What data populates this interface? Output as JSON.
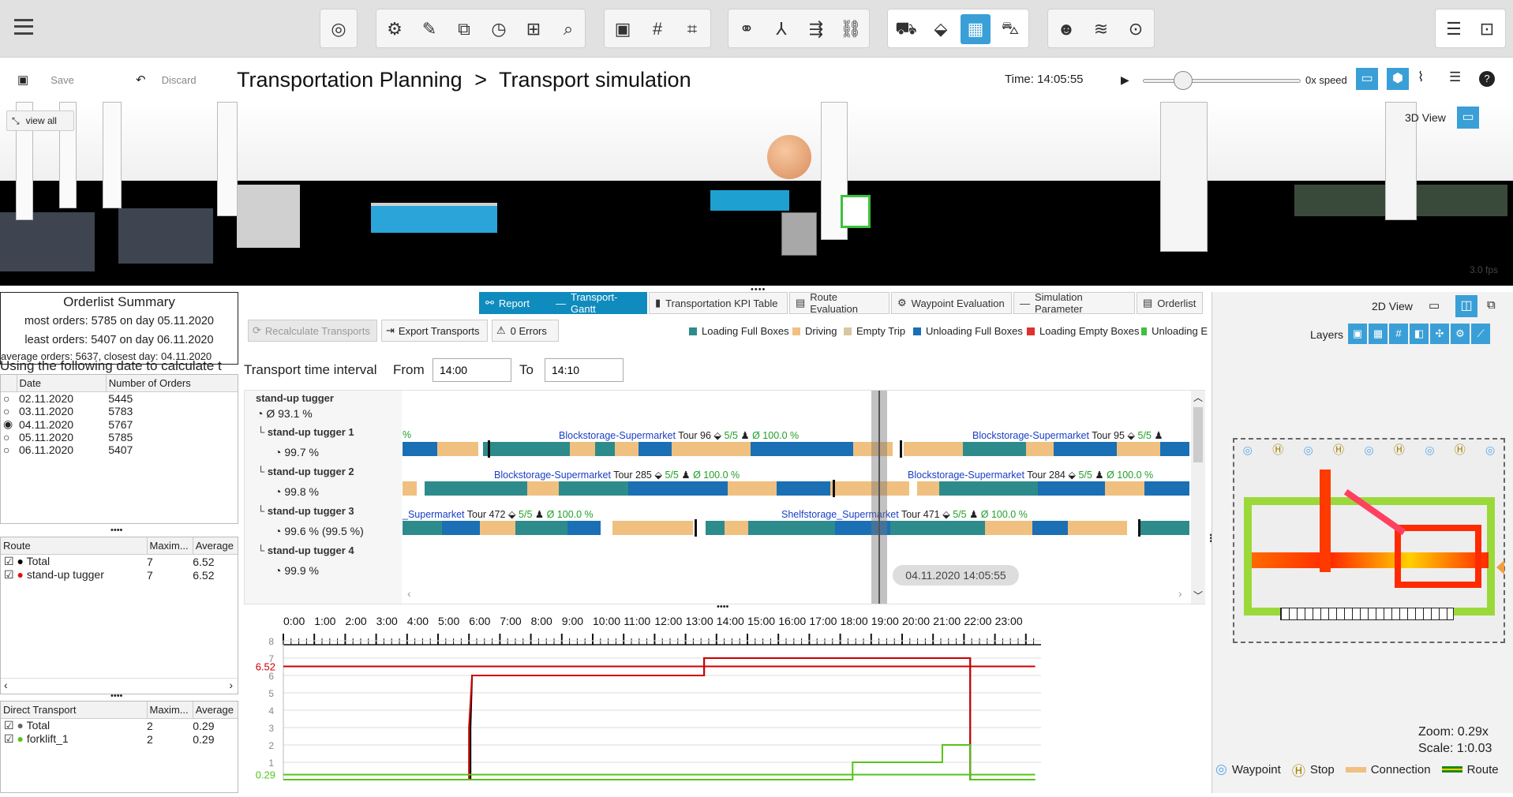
{
  "toolbar": {
    "groups": [
      [
        "target-icon"
      ],
      [
        "settings-cube-icon",
        "ruler-icon",
        "layers-icon",
        "clock-icon",
        "grid-dots-icon",
        "search-zoom-icon"
      ],
      [
        "frame-icon",
        "grid-icon",
        "corner-icon"
      ],
      [
        "link-icon",
        "branch-icon",
        "merge-icon",
        "chain-icon"
      ],
      [
        "conveyor-icon",
        "box-icon",
        "table-icon",
        "forklift-icon"
      ],
      [
        "people-icon",
        "coins-icon",
        "target-box-icon"
      ]
    ],
    "active": "table-icon"
  },
  "header": {
    "save_label": "Save",
    "discard_label": "Discard",
    "breadcrumb": "Transportation Planning",
    "separator": ">",
    "page": "Transport simulation",
    "time_label": "Time: 14:05:55",
    "speed_label": "0x speed"
  },
  "view3d": {
    "view_all": "view all",
    "mode_label": "3D View",
    "fps": "3.0 fps"
  },
  "orderlist": {
    "title": "Orderlist Summary",
    "most": "most orders: 5785 on day 05.11.2020",
    "least": "least orders: 5407 on day 06.11.2020",
    "average": "average orders: 5637, closest day: 04.11.2020",
    "using": "Using the following date to calculate t",
    "columns": [
      "Date",
      "Number of Orders"
    ],
    "rows": [
      {
        "date": "02.11.2020",
        "orders": "5445",
        "selected": false
      },
      {
        "date": "03.11.2020",
        "orders": "5783",
        "selected": false
      },
      {
        "date": "04.11.2020",
        "orders": "5767",
        "selected": true
      },
      {
        "date": "05.11.2020",
        "orders": "5785",
        "selected": false
      },
      {
        "date": "06.11.2020",
        "orders": "5407",
        "selected": false
      }
    ]
  },
  "routes": {
    "columns": [
      "Route",
      "Maxim...",
      "Average"
    ],
    "rows": [
      {
        "name": "Total",
        "max": "7",
        "avg": "6.52",
        "color": "#000000"
      },
      {
        "name": "stand-up tugger",
        "max": "7",
        "avg": "6.52",
        "color": "#e01010"
      }
    ]
  },
  "direct": {
    "columns": [
      "Direct Transport",
      "Maxim...",
      "Average"
    ],
    "rows": [
      {
        "name": "Total",
        "max": "2",
        "avg": "0.29",
        "color": "#666666"
      },
      {
        "name": "forklift_1",
        "max": "2",
        "avg": "0.29",
        "color": "#55c41a"
      }
    ]
  },
  "tabs": [
    "Report",
    "Transport-Gantt",
    "Transportation KPI Table",
    "Route Evaluation",
    "Waypoint Evaluation",
    "Simulation Parameter",
    "Orderlist"
  ],
  "actions": {
    "recalc": "Recalculate Transports",
    "export": "Export Transports",
    "errors": "0 Errors"
  },
  "legend": [
    {
      "label": "Loading Full Boxes",
      "color": "#2e8b8b"
    },
    {
      "label": "Driving",
      "color": "#f0c080"
    },
    {
      "label": "Empty Trip",
      "color": "#d8c8a0"
    },
    {
      "label": "Unloading Full Boxes",
      "color": "#1a6fb5"
    },
    {
      "label": "Loading Empty Boxes",
      "color": "#e03030"
    },
    {
      "label": "Unloading E",
      "color": "#40c040"
    }
  ],
  "interval": {
    "label": "Transport time interval",
    "from_label": "From",
    "from": "14:00",
    "to_label": "To",
    "to": "14:10"
  },
  "gantt": {
    "group": "stand-up tugger",
    "group_pct": "Ø 93.1 %",
    "rows": [
      {
        "name": "stand-up tugger 1",
        "pct": "99.7 %"
      },
      {
        "name": "stand-up tugger 2",
        "pct": "99.8 %"
      },
      {
        "name": "stand-up tugger 3",
        "pct": "99.6 % (99.5 %)"
      },
      {
        "name": "stand-up tugger 4",
        "pct": "99.9 %"
      }
    ],
    "tours": [
      {
        "row": 0,
        "pre": "%",
        "tour": "Blockstorage-Supermarket",
        "num": "Tour 96",
        "cnt": "5/5",
        "ok": "Ø 100.0 %"
      },
      {
        "row": 0,
        "tour": "Blockstorage-Supermarket",
        "num": "Tour 95",
        "cnt": "5/5"
      },
      {
        "row": 1,
        "tour": "Blockstorage-Supermarket",
        "num": "Tour 285",
        "cnt": "5/5",
        "ok": "Ø 100.0 %"
      },
      {
        "row": 1,
        "tour": "Blockstorage-Supermarket",
        "num": "Tour 284",
        "cnt": "5/5",
        "ok": "Ø 100.0 %"
      },
      {
        "row": 2,
        "tour": "_Supermarket",
        "num": "Tour 472",
        "cnt": "5/5",
        "ok": "Ø 100.0 %"
      },
      {
        "row": 2,
        "tour": "Shelfstorage_Supermarket",
        "num": "Tour 471",
        "cnt": "5/5",
        "ok": "Ø 100.0 %"
      }
    ],
    "timestamp": "04.11.2020 14:05:55"
  },
  "chart_data": {
    "type": "line",
    "x_labels": [
      "0:00",
      "1:00",
      "2:00",
      "3:00",
      "4:00",
      "5:00",
      "6:00",
      "7:00",
      "8:00",
      "9:00",
      "10:00",
      "11:00",
      "12:00",
      "13:00",
      "14:00",
      "15:00",
      "16:00",
      "17:00",
      "18:00",
      "19:00",
      "20:00",
      "21:00",
      "22:00",
      "23:00"
    ],
    "y_ticks": [
      "8",
      "7",
      "6",
      "5",
      "4",
      "3",
      "2",
      "1"
    ],
    "ylim": [
      0,
      8
    ],
    "average_labels": [
      "6.52",
      "0.29"
    ],
    "series": [
      {
        "color": "#000000",
        "points": [
          [
            0,
            0
          ],
          [
            6.05,
            0
          ],
          [
            6.05,
            3
          ],
          [
            6.1,
            6
          ],
          [
            13.6,
            6
          ],
          [
            13.6,
            7
          ],
          [
            22.2,
            7
          ],
          [
            22.2,
            0
          ],
          [
            24.3,
            0
          ]
        ]
      },
      {
        "color": "#cc0000",
        "points": [
          [
            0,
            0
          ],
          [
            6.0,
            0
          ],
          [
            6.0,
            3
          ],
          [
            6.1,
            6
          ],
          [
            13.6,
            6
          ],
          [
            13.6,
            7
          ],
          [
            22.2,
            7
          ],
          [
            22.2,
            0
          ],
          [
            24.3,
            0
          ]
        ]
      },
      {
        "color": "#55c41a",
        "points": [
          [
            0,
            0
          ],
          [
            18.4,
            0
          ],
          [
            18.4,
            1
          ],
          [
            21.3,
            1
          ],
          [
            21.3,
            2
          ],
          [
            22.2,
            2
          ],
          [
            22.2,
            0
          ],
          [
            24.3,
            0
          ]
        ]
      },
      {
        "color": "#cc0000",
        "points": [
          [
            0,
            6.52
          ],
          [
            24.3,
            6.52
          ]
        ]
      },
      {
        "color": "#55c41a",
        "points": [
          [
            0,
            0.29
          ],
          [
            24.3,
            0.29
          ]
        ]
      }
    ]
  },
  "view2d": {
    "label": "2D View",
    "layers": "Layers",
    "zoom": "Zoom: 0.29x",
    "scale": "Scale: 1:0.03",
    "legend": [
      "Waypoint",
      "Stop",
      "Connection",
      "Route"
    ]
  }
}
